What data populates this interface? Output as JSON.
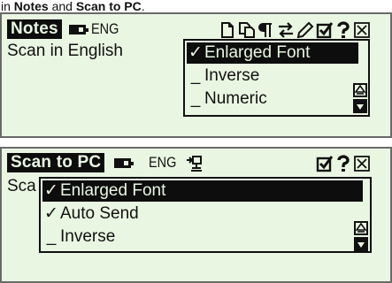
{
  "caption": {
    "prefix": "in ",
    "first": "Notes",
    "middle": " and ",
    "second": "Scan to PC",
    "suffix": "."
  },
  "screens": [
    {
      "title": "Notes",
      "language": "ENG",
      "icons": [
        "new-document-icon",
        "copy-document-icon",
        "paragraph-icon",
        "swap-arrows-icon",
        "pencil-icon",
        "checkbox-icon",
        "help-icon",
        "close-icon"
      ],
      "body_text": "Scan in English",
      "menu": {
        "items": [
          {
            "mark": "✓",
            "label": "Enlarged Font",
            "selected": true
          },
          {
            "mark": "_",
            "label": "Inverse",
            "selected": false
          },
          {
            "mark": "_",
            "label": "Numeric",
            "selected": false
          }
        ]
      }
    },
    {
      "title": "Scan to PC",
      "language": "ENG",
      "icons": [
        "pc-connect-icon",
        "checkbox-icon",
        "help-icon",
        "close-icon"
      ],
      "body_text": "Sca",
      "menu": {
        "items": [
          {
            "mark": "✓",
            "label": "Enlarged Font",
            "selected": true
          },
          {
            "mark": "✓",
            "label": "Auto Send",
            "selected": false
          },
          {
            "mark": "_",
            "label": "Inverse",
            "selected": false
          }
        ]
      }
    }
  ],
  "colors": {
    "lcd_background": "#e9f6e2",
    "ink": "#0d0d0d",
    "bezel": "#6a6a6a"
  }
}
